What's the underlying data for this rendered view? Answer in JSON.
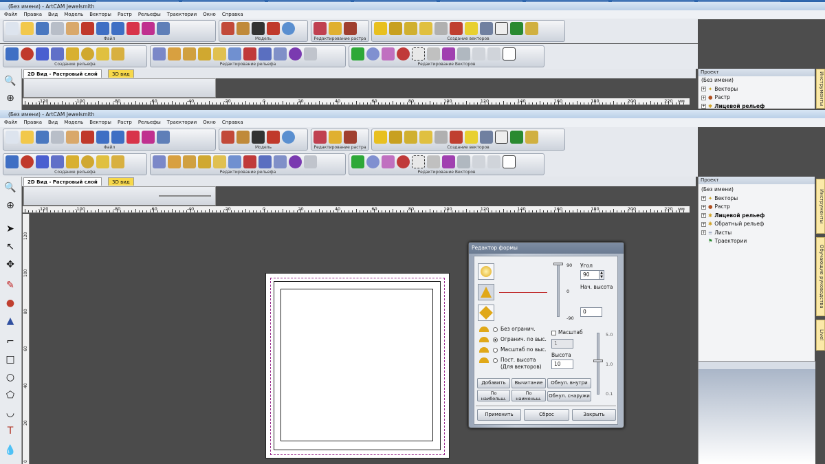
{
  "app": {
    "title_top": "(Без имени) - ArtCAM Jewelsmith",
    "title_bottom": "(Без имени) - ArtCAM Jewelsmith"
  },
  "menu": [
    "Файл",
    "Правка",
    "Вид",
    "Модель",
    "Векторы",
    "Растр",
    "Рельефы",
    "Траектории",
    "Окно",
    "Справка"
  ],
  "toolbars": {
    "row1_captions": [
      "Файл",
      "Модель",
      "Редактирование растра",
      "Создание векторов"
    ],
    "row2_captions": [
      "Создание рельефа",
      "Редактирование рельефа",
      "Редактирование Векторов"
    ]
  },
  "view_tabs": {
    "tab2d": "2D Вид - Растровый слой",
    "tab3d": "3D вид"
  },
  "ruler": {
    "h_labels": [
      "-120",
      "-100",
      "-80",
      "-60",
      "-40",
      "-20",
      "0",
      "20",
      "40",
      "60",
      "80",
      "100",
      "120",
      "140",
      "160",
      "180",
      "200",
      "220"
    ],
    "h_unit": "мм",
    "v_labels": [
      "120",
      "100",
      "80",
      "60",
      "40",
      "20",
      "0"
    ]
  },
  "project": {
    "header": "Проект",
    "root": "(Без имени)",
    "items": [
      "Векторы",
      "Растр",
      "Лицевой рельеф",
      "Обратный рельеф",
      "Листы",
      "Траектории"
    ],
    "items_top_truncated": [
      "Векторы",
      "Растр",
      "Лицевой рельеф"
    ]
  },
  "side_tabs": [
    "Инструменты",
    "Обучающие руководства",
    "Live!"
  ],
  "dialog": {
    "title": "Редактор формы",
    "angle_label": "Угол",
    "angle_value": "90",
    "start_height_label": "Нач. высота",
    "start_height_value": "0",
    "slider_top": "90",
    "slider_mid": "0",
    "slider_bottom": "-90",
    "opt_unlimited": "Без огранич.",
    "opt_limit_height": "Огранич. по выс.",
    "opt_scale_height": "Масштаб по выс.",
    "opt_const_height": "Пост. высота",
    "opt_const_height_sub": "(Для векторов)",
    "scale_checkbox": "Масштаб",
    "scale_value": "1",
    "height_label": "Высота",
    "height_value": "10",
    "scale_slider_top": "5.0",
    "scale_slider_mid": "1.0",
    "scale_slider_bottom": "0.1",
    "btn_add": "Добавить",
    "btn_subtract": "Вычитание",
    "btn_zero_inside": "Обнул. внутри",
    "btn_by_max": "По наибольш.",
    "btn_by_min": "По наименьш.",
    "btn_zero_outside": "Обнул. снаружи",
    "btn_apply": "Применить",
    "btn_reset": "Сброс",
    "btn_close": "Закрыть"
  },
  "colors": {
    "canvas": "#4d4d4d",
    "dialog_accent": "#c03030",
    "vector_dash": "#9a2b8d"
  }
}
